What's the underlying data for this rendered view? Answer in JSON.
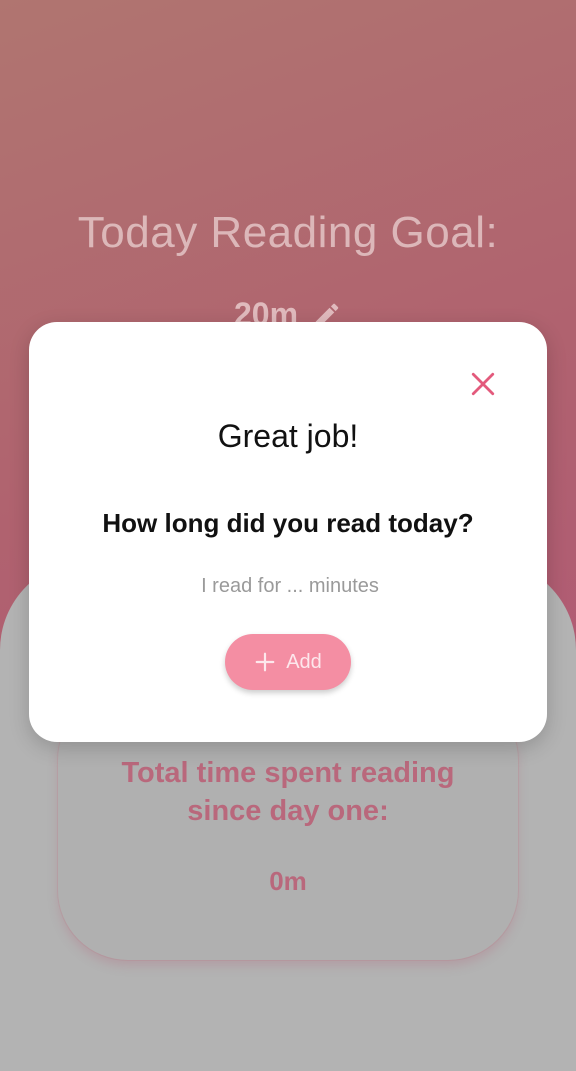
{
  "background": {
    "gradient_colors": [
      "#b07570",
      "#b0626f",
      "#b15a75"
    ],
    "overlay_color": "#b3b3b3"
  },
  "goal": {
    "title": "Today Reading Goal:",
    "value": "20m",
    "edit_icon": "pencil-icon"
  },
  "stats": {
    "label": "Total time spent reading\nsince day one:",
    "value": "0m",
    "accent_color": "#b9687c"
  },
  "dialog": {
    "close_icon": "close-icon",
    "close_color": "#e35a7c",
    "title": "Great job!",
    "question": "How long did you read today?",
    "input": {
      "placeholder": "I read for ... minutes",
      "value": ""
    },
    "add_button": {
      "label": "Add",
      "icon": "plus-icon",
      "color": "#f48ea3"
    }
  }
}
